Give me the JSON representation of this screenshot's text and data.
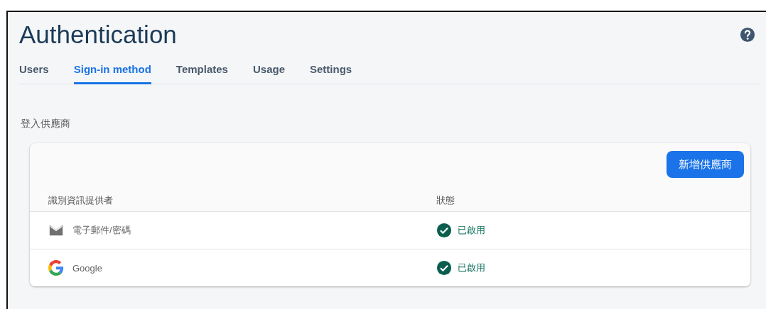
{
  "page": {
    "title": "Authentication"
  },
  "tabs": [
    {
      "label": "Users",
      "selected": false
    },
    {
      "label": "Sign-in method",
      "selected": true
    },
    {
      "label": "Templates",
      "selected": false
    },
    {
      "label": "Usage",
      "selected": false
    },
    {
      "label": "Settings",
      "selected": false
    }
  ],
  "section": {
    "heading": "登入供應商"
  },
  "providers_table": {
    "add_button": "新增供應商",
    "columns": [
      "識別資訊提供者",
      "狀態"
    ],
    "rows": [
      {
        "kind": "email",
        "name": "電子郵件/密碼",
        "enabled": true,
        "status": "已啟用"
      },
      {
        "kind": "google",
        "name": "Google",
        "enabled": true,
        "status": "已啟用"
      }
    ]
  }
}
